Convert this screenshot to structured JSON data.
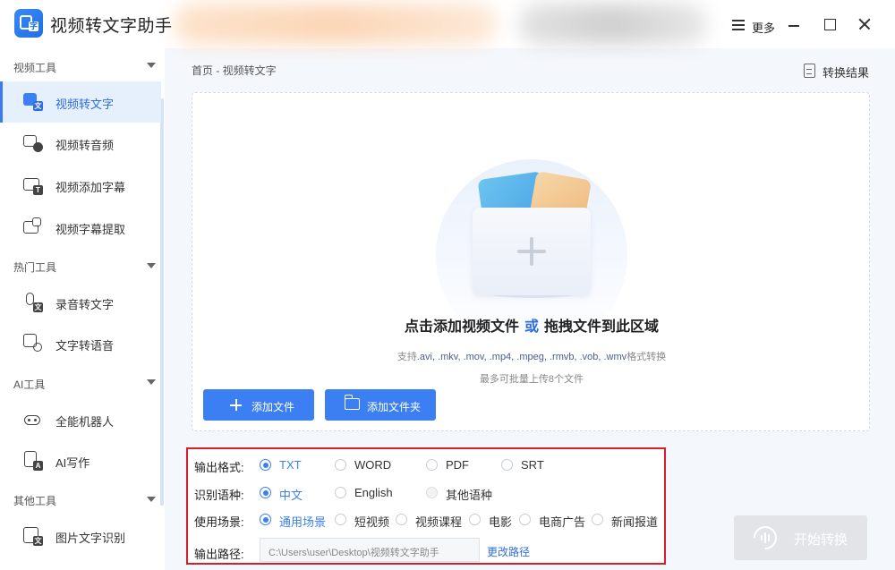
{
  "window": {
    "title": "视频转文字助手",
    "more_label": "更多"
  },
  "sidebar": {
    "groups": [
      {
        "label": "视频工具",
        "items": [
          {
            "label": "视频转文字",
            "active": true
          },
          {
            "label": "视频转音频"
          },
          {
            "label": "视频添加字幕"
          },
          {
            "label": "视频字幕提取"
          }
        ]
      },
      {
        "label": "热门工具",
        "items": [
          {
            "label": "录音转文字"
          },
          {
            "label": "文字转语音"
          }
        ]
      },
      {
        "label": "AI工具",
        "items": [
          {
            "label": "全能机器人"
          },
          {
            "label": "AI写作"
          }
        ]
      },
      {
        "label": "其他工具",
        "items": [
          {
            "label": "图片文字识别"
          }
        ]
      }
    ]
  },
  "main": {
    "breadcrumb": "首页 - 视频转文字",
    "result_label": "转换结果",
    "dropzone": {
      "headline_part1": "点击添加视频文件",
      "headline_or": "或",
      "headline_part2": "拖拽文件到此区域",
      "formats_prefix": "支持",
      "formats_list": ".avi, .mkv, .mov, .mp4, .mpeg, .rmvb, .vob, .wmv",
      "formats_suffix": "格式转换",
      "limit": "最多可批量上传8个文件",
      "add_file_label": "添加文件",
      "add_folder_label": "添加文件夹"
    }
  },
  "options": {
    "output_format": {
      "label": "输出格式:",
      "options": [
        "TXT",
        "WORD",
        "PDF",
        "SRT"
      ],
      "selected": "TXT"
    },
    "language": {
      "label": "识别语种:",
      "options": [
        "中文",
        "English",
        "其他语种"
      ],
      "selected": "中文"
    },
    "scenario": {
      "label": "使用场景:",
      "options": [
        "通用场景",
        "短视频",
        "视频课程",
        "电影",
        "电商广告",
        "新闻报道"
      ],
      "selected": "通用场景"
    },
    "output_path": {
      "label": "输出路径:",
      "value": "C:\\Users\\user\\Desktop\\视频转文字助手",
      "change_label": "更改路径"
    }
  },
  "start_button": {
    "label": "开始转换",
    "enabled": false
  },
  "colors": {
    "accent": "#3b7ff2",
    "highlight_border": "#d81e2a",
    "sidebar_active_bg": "#e6effc"
  }
}
